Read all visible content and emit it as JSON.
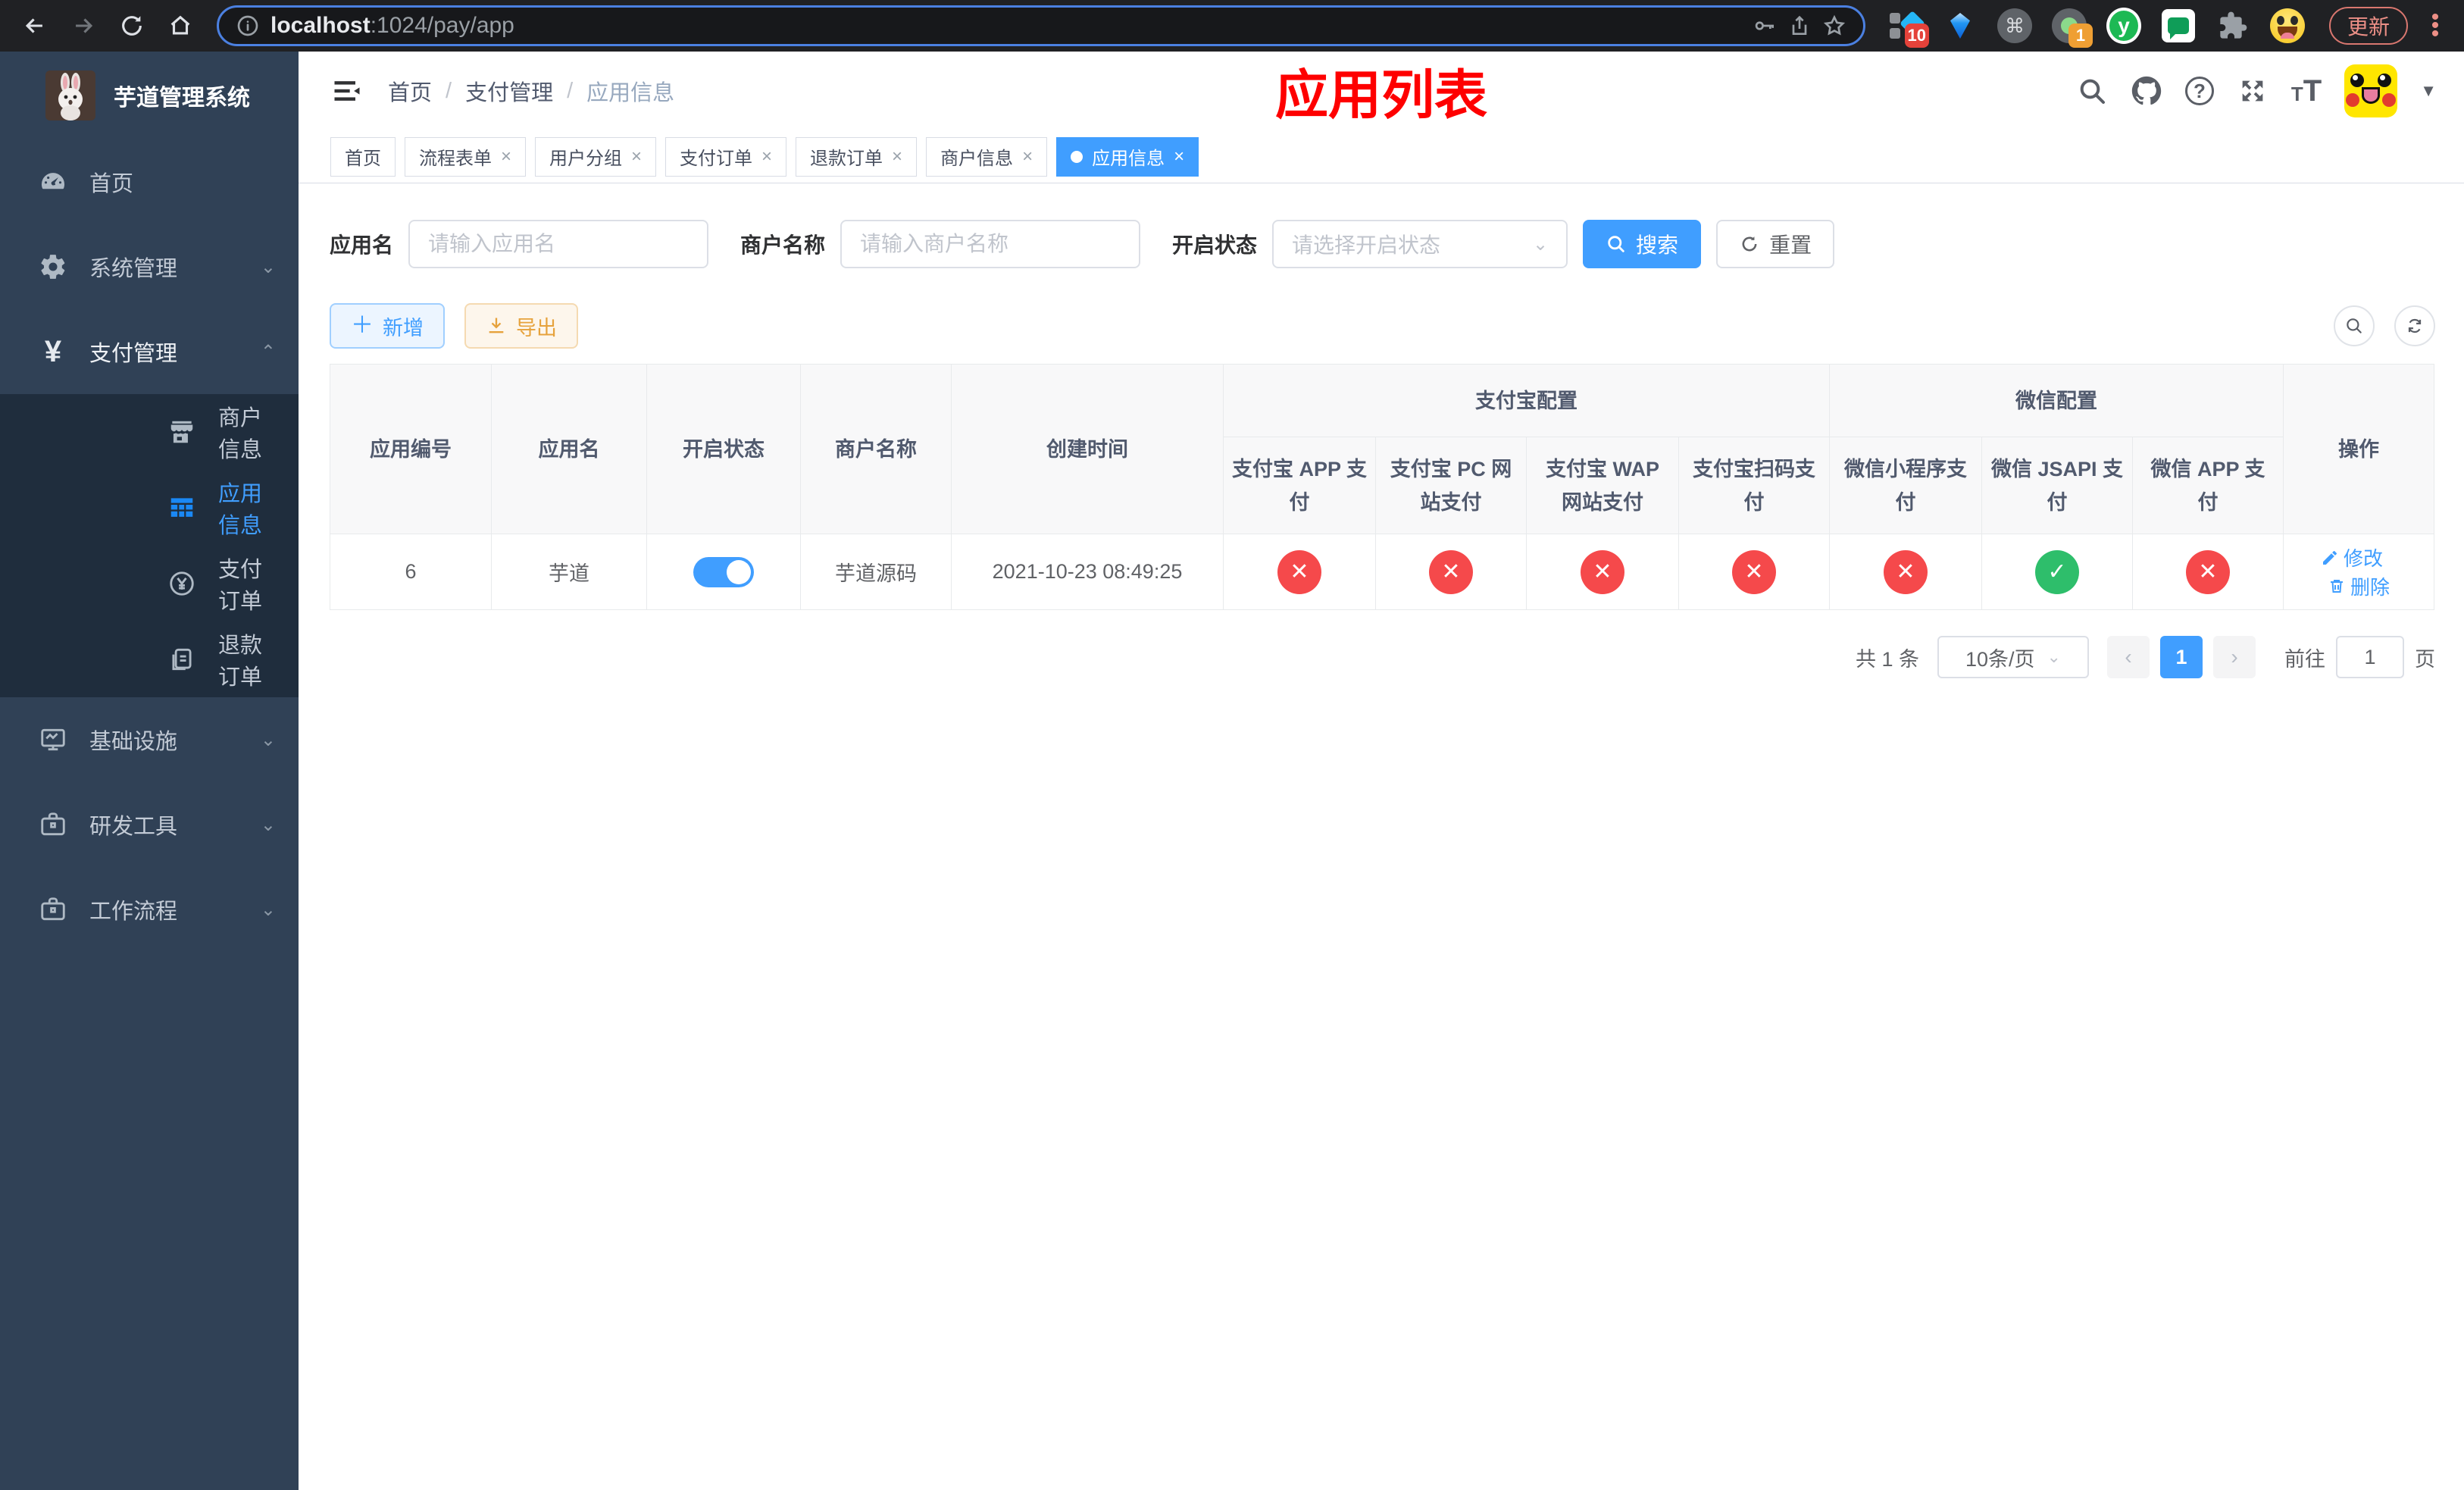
{
  "browser": {
    "url_host": "localhost",
    "url_path": ":1024/pay/app",
    "update_label": "更新",
    "ext_badges": {
      "pinned": "10",
      "recorder": "1"
    }
  },
  "sidebar": {
    "title": "芋道管理系统",
    "menu": [
      {
        "label": "首页"
      },
      {
        "label": "系统管理"
      },
      {
        "label": "支付管理"
      },
      {
        "label": "基础设施"
      },
      {
        "label": "研发工具"
      },
      {
        "label": "工作流程"
      }
    ],
    "payment_submenu": [
      {
        "label": "商户信息"
      },
      {
        "label": "应用信息"
      },
      {
        "label": "支付订单"
      },
      {
        "label": "退款订单"
      }
    ]
  },
  "header": {
    "breadcrumb": [
      "首页",
      "支付管理",
      "应用信息"
    ],
    "annotation": "应用列表"
  },
  "tags": [
    {
      "label": "首页"
    },
    {
      "label": "流程表单"
    },
    {
      "label": "用户分组"
    },
    {
      "label": "支付订单"
    },
    {
      "label": "退款订单"
    },
    {
      "label": "商户信息"
    },
    {
      "label": "应用信息"
    }
  ],
  "filter": {
    "app_name_label": "应用名",
    "app_name_placeholder": "请输入应用名",
    "merchant_label": "商户名称",
    "merchant_placeholder": "请输入商户名称",
    "status_label": "开启状态",
    "status_placeholder": "请选择开启状态",
    "search_label": "搜索",
    "reset_label": "重置"
  },
  "toolbar": {
    "add_label": "新增",
    "export_label": "导出"
  },
  "table": {
    "headers": {
      "app_id": "应用编号",
      "app_name": "应用名",
      "status": "开启状态",
      "merchant": "商户名称",
      "created": "创建时间",
      "alipay_group": "支付宝配置",
      "wechat_group": "微信配置",
      "actions": "操作",
      "sub": [
        "支付宝 APP 支付",
        "支付宝 PC 网站支付",
        "支付宝 WAP 网站支付",
        "支付宝扫码支付",
        "微信小程序支付",
        "微信 JSAPI 支付",
        "微信 APP 支付"
      ]
    },
    "rows": [
      {
        "app_id": "6",
        "app_name": "芋道",
        "status_on": true,
        "merchant": "芋道源码",
        "created": "2021-10-23 08:49:25",
        "configs": [
          "no",
          "no",
          "no",
          "no",
          "no",
          "yes",
          "no"
        ],
        "edit_label": "修改",
        "delete_label": "删除"
      }
    ]
  },
  "pagination": {
    "total": "共 1 条",
    "page_size": "10条/页",
    "page": "1",
    "goto_label": "前往",
    "goto_value": "1",
    "goto_suffix": "页"
  },
  "colors": {
    "accent": "#409eff",
    "success": "#2ebe6b",
    "danger": "#f5494b",
    "warning": "#e6a23c",
    "sidebar_bg": "#304156",
    "submenu_bg": "#1f2d3d"
  }
}
